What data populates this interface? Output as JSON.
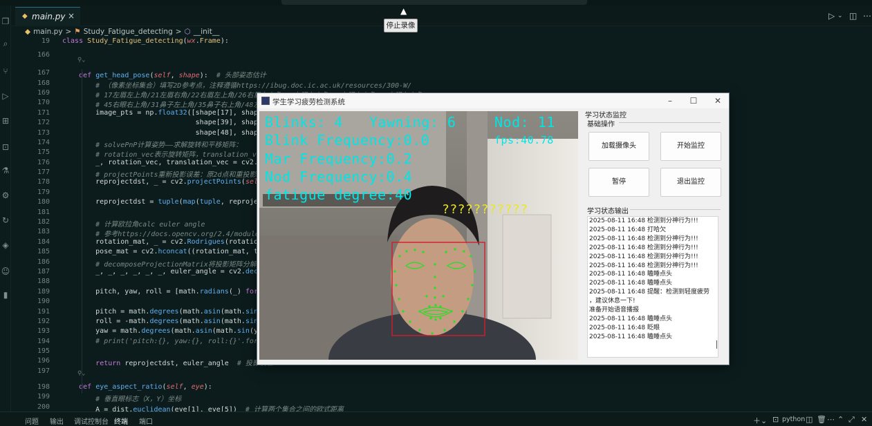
{
  "window": {
    "title_hint": "fatigue_student_detection_system"
  },
  "tab": {
    "file": "main.py",
    "close": "×"
  },
  "breadcrumb": {
    "file": "main.py",
    "sep": ">",
    "class": "Study_Fatigue_detecting",
    "method": "__init__"
  },
  "tooltip": {
    "text": "停止录像"
  },
  "code": [
    {
      "n": "19",
      "html": "<span class=\"kw\">class</span> <span class=\"fn\">Study_Fatigue_detecting</span>(<span class=\"sf\">wx</span>.<span class=\"fn\">Frame</span>):"
    },
    {
      "n": "166",
      "html": ""
    },
    {
      "n": "167",
      "html": "    <span class=\"kw\">def</span> <span class=\"fnc\">get_head_pose</span>(<span class=\"sf\">self</span>, <span class=\"sf\">shape</span>):  <span class=\"cm\"># 头部姿态估计</span>"
    },
    {
      "n": "168",
      "html": "        <span class=\"cm\"># （像素坐标集合）填写2D参考点，注释遵循https://ibug.doc.ic.ac.uk/resources/300-W/</span>"
    },
    {
      "n": "169",
      "html": "        <span class=\"cm\"># 17左眉左上角/21左眉右角/22右眉左上角/26右眉右上角/36左眼左上角/39左眼右上角/42右眼左上角/</span>"
    },
    {
      "n": "170",
      "html": "        <span class=\"cm\"># 45右眼右上角/31鼻子左上角/35鼻子右上角/48左</span>"
    },
    {
      "n": "171",
      "html": "        image_pts = np.<span class=\"fnc\">float32</span>([shape[17], shape[21"
    },
    {
      "n": "172",
      "html": "                                shape[39], shape[42"
    },
    {
      "n": "173",
      "html": "                                shape[48], shape[54"
    },
    {
      "n": "174",
      "html": "        <span class=\"cm\"># solvePnP计算姿势——求解旋转和平移矩阵：</span>"
    },
    {
      "n": "175",
      "html": "        <span class=\"cm\"># rotation_vec表示旋转矩阵，translation_vec表</span>"
    },
    {
      "n": "176",
      "html": "        _, rotation_vec, translation_vec = cv2.<span class=\"fnc\">solve</span>"
    },
    {
      "n": "177",
      "html": "        <span class=\"cm\"># projectPoints重新投影误差：原2d点和重投影2d</span>"
    },
    {
      "n": "178",
      "html": "        reprojectdst, _ = cv2.<span class=\"fnc\">projectPoints</span>(<span class=\"sf\">self</span>.<span class=\"fnc\">re</span>"
    },
    {
      "n": "179",
      "html": "                                               <span class=\"sf\">self</span>.di"
    },
    {
      "n": "180",
      "html": "        reprojectdst = <span class=\"fnc\">tuple</span>(<span class=\"fnc\">map</span>(<span class=\"fnc\">tuple</span>, reprojectdst"
    },
    {
      "n": "181",
      "html": ""
    },
    {
      "n": "182",
      "html": "        <span class=\"cm\"># 计算欧拉角calc euler angle</span>"
    },
    {
      "n": "183",
      "html": "        <span class=\"cm\"># 参考https://docs.opencv.org/2.4/modules/ca</span>"
    },
    {
      "n": "184",
      "html": "        rotation_mat, _ = cv2.<span class=\"fnc\">Rodrigues</span>(rotation_vec"
    },
    {
      "n": "185",
      "html": "        pose_mat = cv2.<span class=\"fnc\">hconcat</span>((rotation_mat, transl"
    },
    {
      "n": "186",
      "html": "        <span class=\"cm\"># decomposeProjectionMatrix将投影矩阵分解为旋</span>"
    },
    {
      "n": "187",
      "html": "        _, _, _, _, _, _, euler_angle = cv2.<span class=\"fnc\">decompos</span>"
    },
    {
      "n": "188",
      "html": ""
    },
    {
      "n": "189",
      "html": "        pitch, yaw, roll = [math.<span class=\"fnc\">radians</span>(_) <span class=\"kw\">for</span> _ <span class=\"kw\">in</span>"
    },
    {
      "n": "190",
      "html": ""
    },
    {
      "n": "191",
      "html": "        pitch = math.<span class=\"fnc\">degrees</span>(math.<span class=\"fnc\">asin</span>(math.<span class=\"fnc\">sin</span>(pit"
    },
    {
      "n": "192",
      "html": "        roll = -math.<span class=\"fnc\">degrees</span>(math.<span class=\"fnc\">asin</span>(math.<span class=\"fnc\">sin</span>(rol"
    },
    {
      "n": "193",
      "html": "        yaw = math.<span class=\"fnc\">degrees</span>(math.<span class=\"fnc\">asin</span>(math.<span class=\"fnc\">sin</span>(yaw))"
    },
    {
      "n": "194",
      "html": "        <span class=\"cm\"># print('pitch:{}, yaw:{}, roll:{}'.format(</span>"
    },
    {
      "n": "195",
      "html": ""
    },
    {
      "n": "196",
      "html": "        <span class=\"kw\">return</span> reprojectdst, euler_angle  <span class=\"cm\"># 投影误差</span>"
    },
    {
      "n": "197",
      "html": ""
    },
    {
      "n": "198",
      "html": "    <span class=\"kw\">def</span> <span class=\"fnc\">eye_aspect_ratio</span>(<span class=\"sf\">self</span>, <span class=\"sf\">eye</span>):"
    },
    {
      "n": "199",
      "html": "        <span class=\"cm\"># 垂直眼标志（X，Y）坐标</span>"
    },
    {
      "n": "200",
      "html": "        A = dist.<span class=\"fnc\">euclidean</span>(eye[1], eye[5])  <span class=\"cm\"># 计算两个集合之间的欧式距离</span>"
    }
  ],
  "panel": {
    "tabs": [
      "问题",
      "输出",
      "调试控制台",
      "终端",
      "端口"
    ],
    "active": "终端",
    "shell": "python"
  },
  "dialog": {
    "title": "学生学习疲劳检测系统",
    "camera_overlay": {
      "blinks": "Blinks: 4",
      "yawning": "Yawning: 6",
      "nod": "Nod: 11",
      "blink_freq": "Blink Frequency:0.0",
      "fps": "fps:40.78",
      "mar_freq": "Mar Frequency:0.2",
      "nod_freq": "Nod Frequency:0.4",
      "fatigue": "fatigue degree:40",
      "status": "???????????"
    },
    "status_group": "学习状态监控",
    "ops_group": "基础操作",
    "buttons": {
      "load_camera": "加载摄像头",
      "start": "开始监控",
      "pause": "暂停",
      "exit": "退出监控"
    },
    "output_group": "学习状态输出",
    "log": [
      "2025-08-11 16:48 检测到分神行为!!!",
      "2025-08-11 16:48 打哈欠",
      "2025-08-11 16:48 检测到分神行为!!!",
      "2025-08-11 16:48 检测到分神行为!!!",
      "2025-08-11 16:48 检测到分神行为!!!",
      "2025-08-11 16:48 检测到分神行为!!!",
      "2025-08-11 16:48 瞌睡点头",
      "2025-08-11 16:48 瞌睡点头",
      "2025-08-11 16:48 提醒：检测到轻度疲劳",
      "，建议休息一下!",
      "准备开始语音播报",
      "2025-08-11 16:48 瞌睡点头",
      "2025-08-11 16:48 眨眼",
      "2025-08-11 16:48 瞌睡点头"
    ]
  }
}
